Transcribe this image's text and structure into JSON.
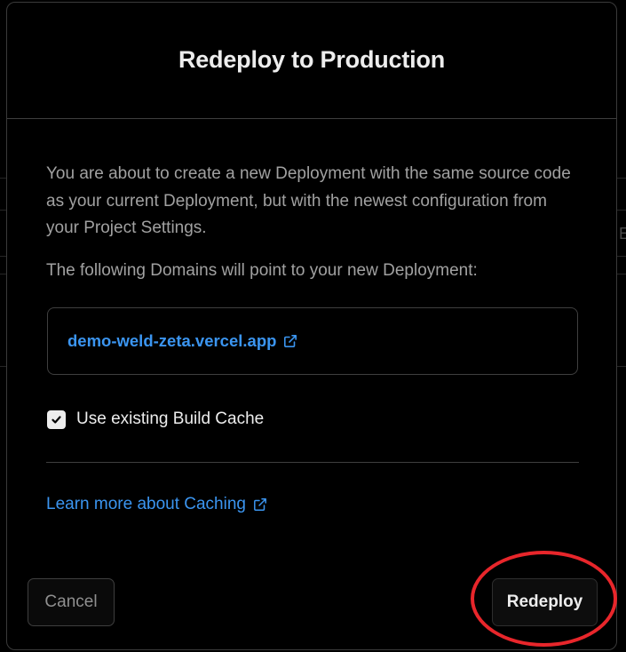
{
  "modal": {
    "title": "Redeploy to Production",
    "description": "You are about to create a new Deployment with the same source code as your current Deployment, but with the newest configuration from your Project Settings.",
    "domains_label": "The following Domains will point to your new Deployment:",
    "domains": [
      "demo-weld-zeta.vercel.app"
    ],
    "build_cache": {
      "label": "Use existing Build Cache",
      "checked": true
    },
    "learn_more_label": "Learn more about Caching",
    "cancel_label": "Cancel",
    "redeploy_label": "Redeploy"
  },
  "background": {
    "partial_glyph": "E"
  },
  "icons": {
    "external_link": "external-link-icon",
    "checkmark": "checkmark-icon"
  },
  "colors": {
    "link": "#3b95f0",
    "highlight_ring": "#e8262b",
    "text_primary": "#ededed",
    "text_secondary": "#a1a1a1"
  }
}
